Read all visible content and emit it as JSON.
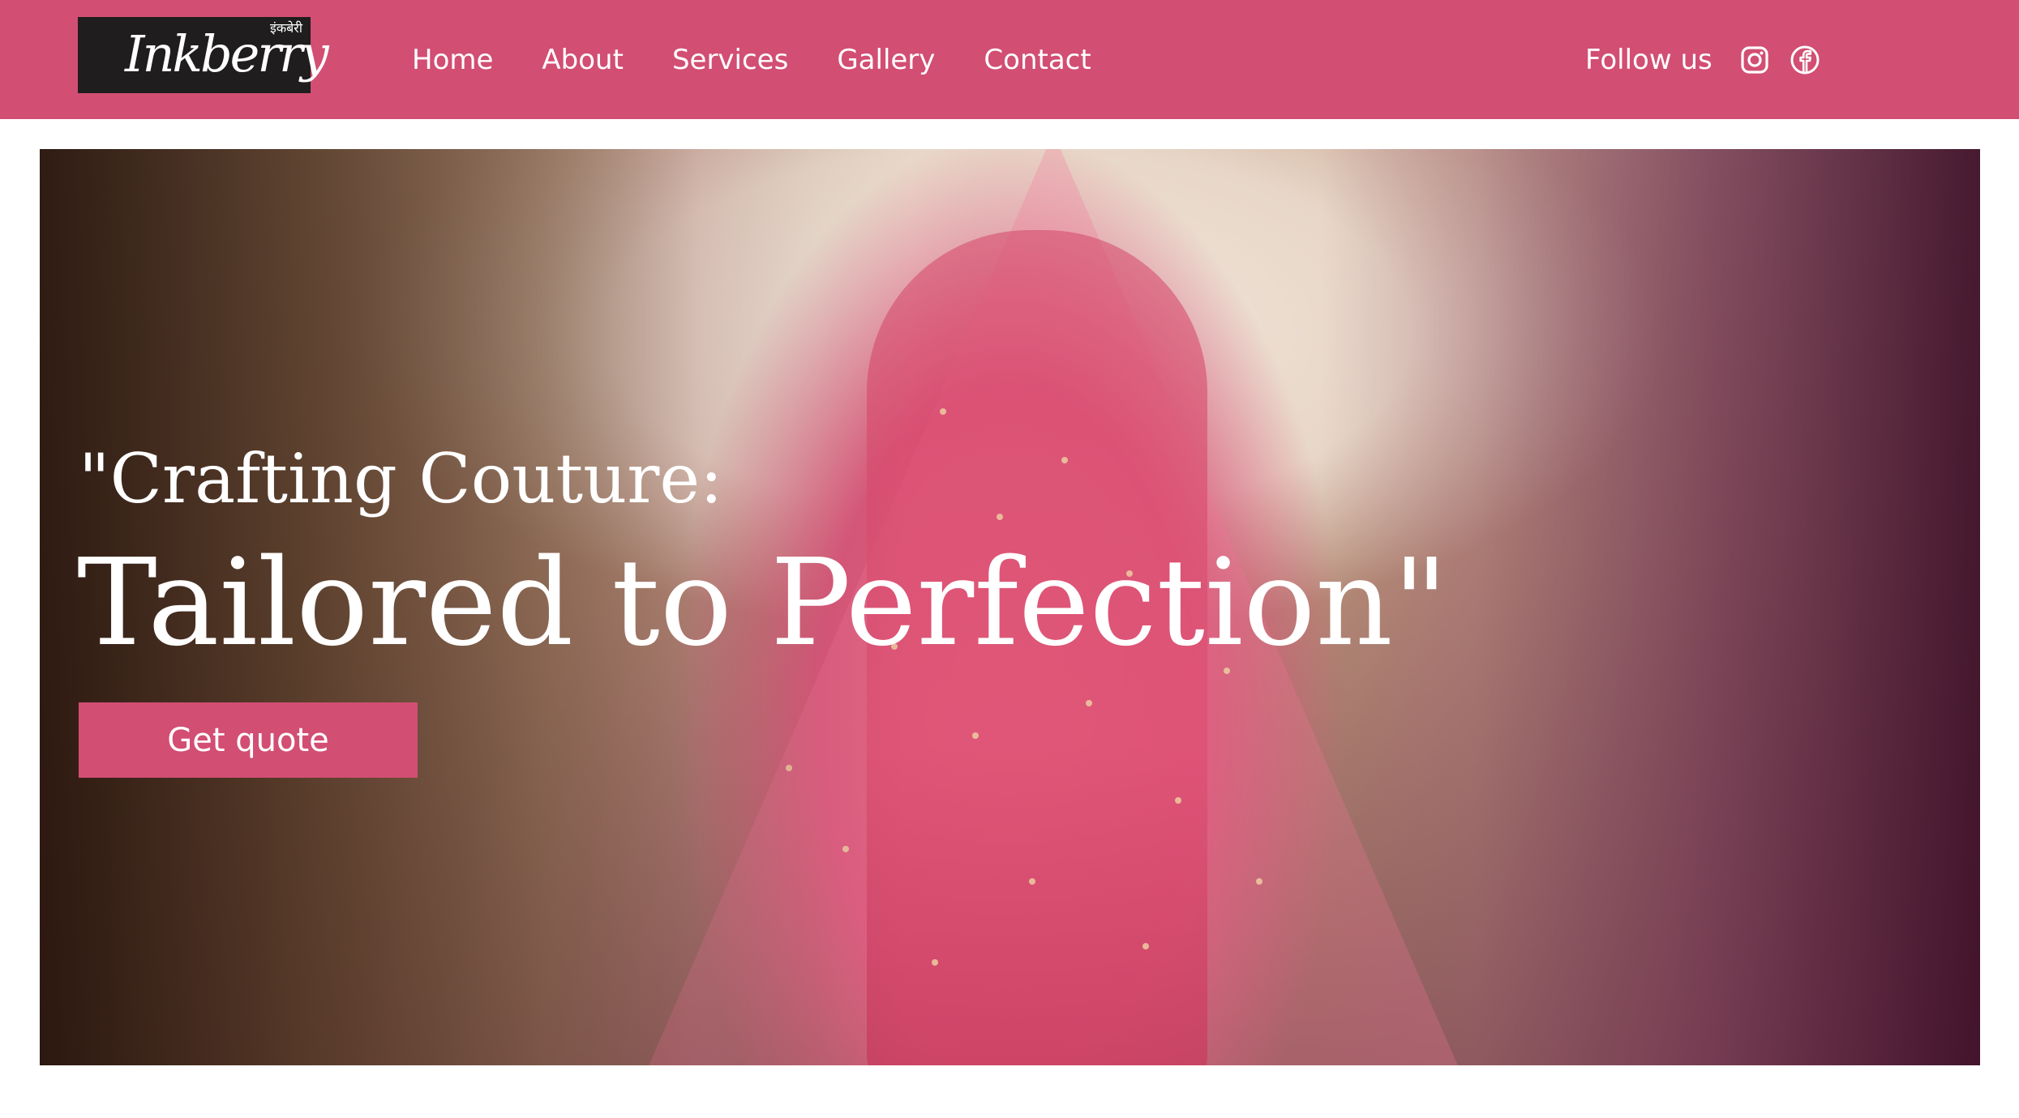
{
  "brand": {
    "logo_text": "Inkberry",
    "logo_hindi": "इंकबेरी"
  },
  "nav": {
    "items": [
      {
        "label": "Home"
      },
      {
        "label": "About"
      },
      {
        "label": "Services"
      },
      {
        "label": "Gallery"
      },
      {
        "label": "Contact"
      }
    ]
  },
  "social": {
    "label": "Follow us",
    "icons": [
      "instagram-icon",
      "facebook-icon"
    ]
  },
  "hero": {
    "subtitle": "\"Crafting Couture:",
    "title": "Tailored to Perfection\"",
    "cta_label": "Get quote"
  },
  "colors": {
    "brand_pink": "#d24e73",
    "logo_bg": "#1f1d1e",
    "text_white": "#ffffff"
  }
}
